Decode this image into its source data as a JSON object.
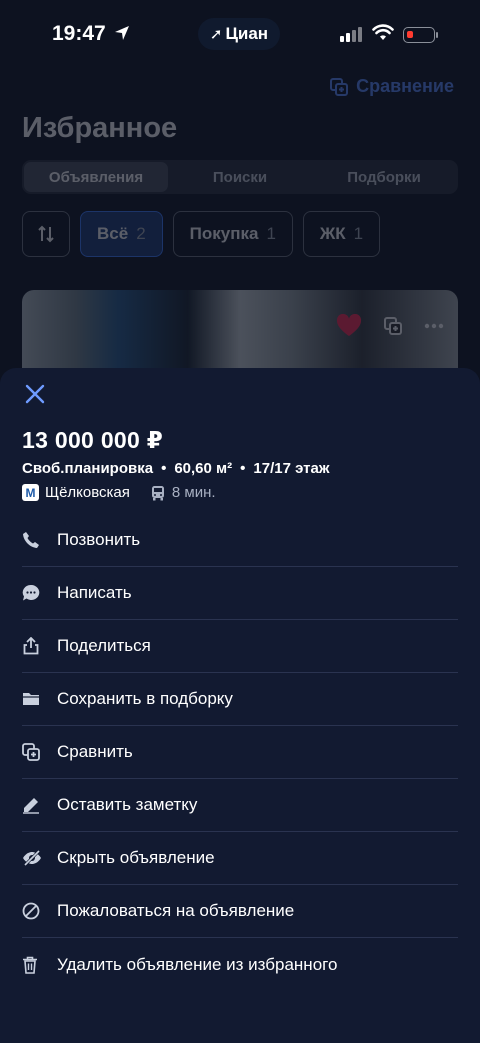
{
  "status_bar": {
    "time": "19:47",
    "island_label": "Циан"
  },
  "background_page": {
    "compare_link": "Сравнение",
    "title": "Избранное",
    "tabs": [
      "Объявления",
      "Поиски",
      "Подборки"
    ],
    "active_tab": 0,
    "chips": [
      {
        "label": "Всё",
        "count": "2",
        "active": true
      },
      {
        "label": "Покупка",
        "count": "1",
        "active": false
      },
      {
        "label": "ЖК",
        "count": "1",
        "active": false
      }
    ]
  },
  "sheet": {
    "price": "13 000 000 ₽",
    "specs": {
      "layout": "Своб.планировка",
      "area": "60,60 м²",
      "floor": "17/17 этаж"
    },
    "metro": {
      "badge": "М",
      "station": "Щёлковская",
      "travel_time": "8 мин."
    },
    "actions": [
      {
        "label": "Позвонить",
        "icon": "phone-icon"
      },
      {
        "label": "Написать",
        "icon": "chat-icon"
      },
      {
        "label": "Поделиться",
        "icon": "share-icon"
      },
      {
        "label": "Сохранить в подборку",
        "icon": "folder-icon"
      },
      {
        "label": "Сравнить",
        "icon": "compare-icon"
      },
      {
        "label": "Оставить заметку",
        "icon": "pencil-icon"
      },
      {
        "label": "Скрыть объявление",
        "icon": "hide-icon"
      },
      {
        "label": "Пожаловаться на объявление",
        "icon": "report-icon"
      },
      {
        "label": "Удалить объявление из избранного",
        "icon": "trash-icon"
      }
    ]
  },
  "colors": {
    "sheet_background": "#121a31",
    "accent": "#3d7bff",
    "metro_line": "#1e5aa8"
  }
}
